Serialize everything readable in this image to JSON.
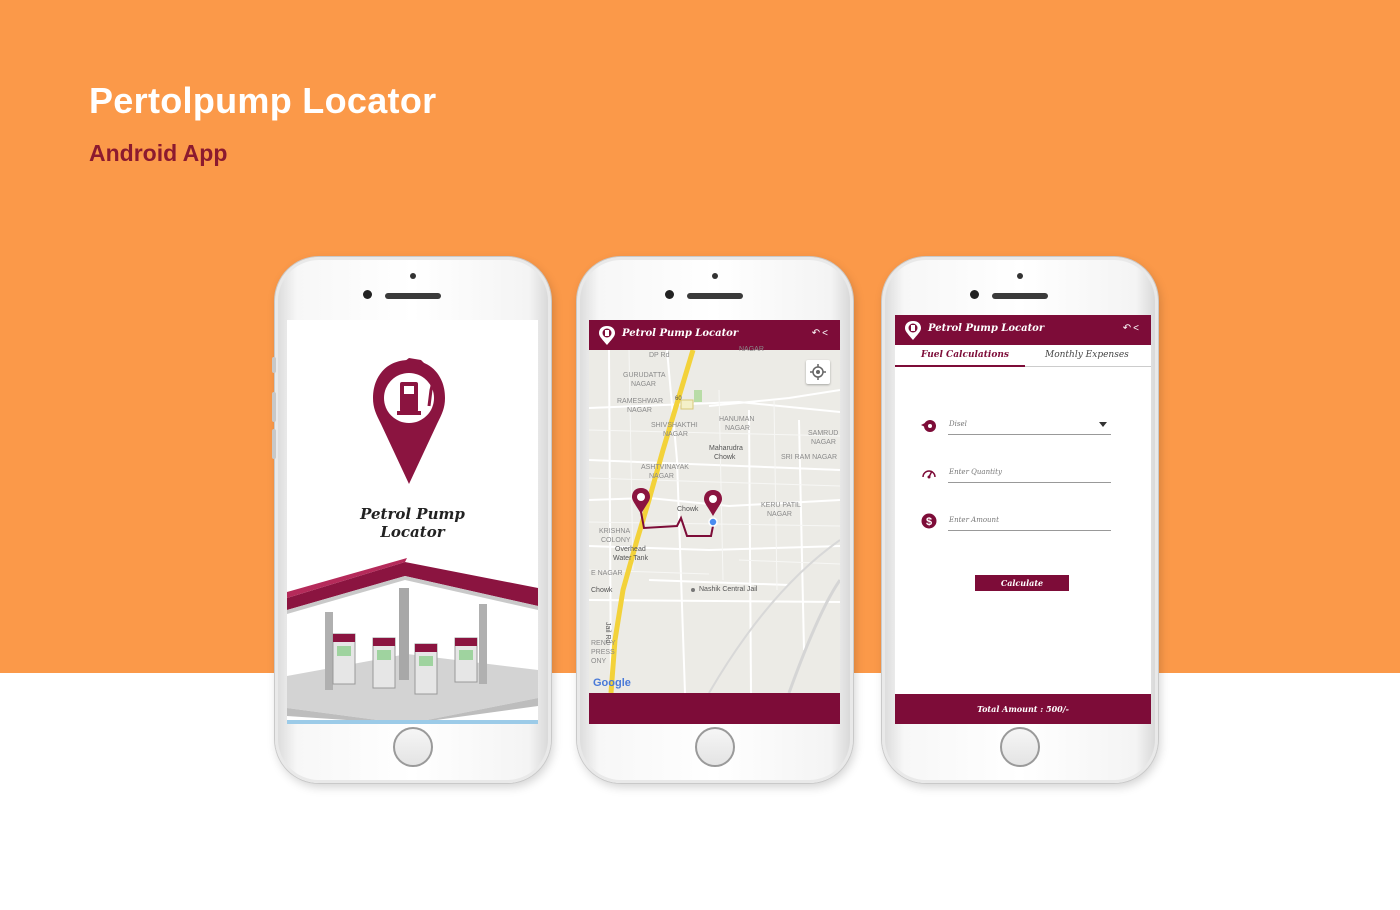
{
  "hero": {
    "title": "Pertolpump Locator",
    "subtitle": "Android App"
  },
  "colors": {
    "background_top": "#fb9949",
    "brand": "#7d0c38",
    "subtitle": "#8c1a2f"
  },
  "splash": {
    "title_line1": "Petrol Pump",
    "title_line2": "Locator",
    "logo_icon": "fuel-pin-icon",
    "illustration": "petrol-station-illustration"
  },
  "map_screen": {
    "app_title": "Petrol Pump Locator",
    "toolbar_icons": [
      "undo-icon",
      "share-icon"
    ],
    "labels": {
      "dp_rd": "DP Rd",
      "gurudatta": "GURUDATTA",
      "nagar1": "NAGAR",
      "rameshwar": "RAMESHWAR",
      "nagar2": "NAGAR",
      "shivshakthi": "SHIVSHAKTHI",
      "nagar3": "NAGAR",
      "hanuman": "HANUMAN",
      "nagar4": "NAGAR",
      "samrud": "SAMRUD",
      "nagar5": "NAGAR",
      "maharudra": "Maharudra",
      "chowk1": "Chowk",
      "sri_ram": "SRI RAM NAGAR",
      "ashtvinayak": "ASHTVINAYAK",
      "nagar6": "NAGAR",
      "chowk2": "Chowk",
      "keru_patil": "KERU PATIL",
      "nagar7": "NAGAR",
      "krishna": "KRISHNA",
      "colony": "COLONY",
      "overhead": "Overhead",
      "water_tank": "Water Tank",
      "e_nagar": "E NAGAR",
      "chowk3": "Chowk",
      "nashik_jail": "Nashik Central Jail",
      "jail_rd": "Jail Rd",
      "rency": "RENCY",
      "press": "PRESS",
      "ony": "ONY",
      "road_num": "60",
      "top_nagar": "NAGAR"
    },
    "google_label": "Google",
    "locate_icon": "my-location-icon"
  },
  "calc_screen": {
    "app_title": "Petrol Pump Locator",
    "tabs": [
      "Fuel Calculations",
      "Monthly Expenses"
    ],
    "fuel_select_value": "Disel",
    "quantity_placeholder": "Enter Quantity",
    "amount_placeholder": "Enter Amount",
    "calculate_label": "Calculate",
    "total_text": "Total Amount : 500/-"
  }
}
